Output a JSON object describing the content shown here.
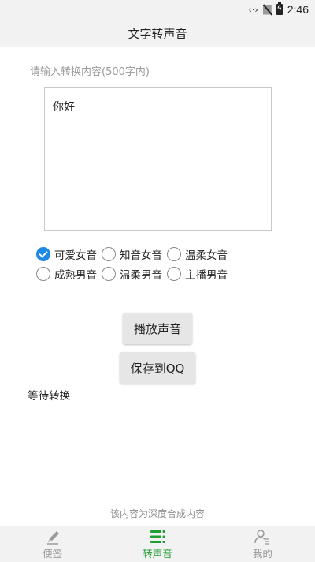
{
  "status_bar": {
    "time": "2:46",
    "network_glyph": "‹·›",
    "icons": [
      "data-icon",
      "no-sim-icon",
      "battery-charging-icon"
    ]
  },
  "app_bar": {
    "title": "文字转声音"
  },
  "input": {
    "hint": "请输入转换内容(500字内)",
    "value": "你好"
  },
  "voices": [
    {
      "label": "可爱女音",
      "checked": true
    },
    {
      "label": "知音女音",
      "checked": false
    },
    {
      "label": "温柔女音",
      "checked": false
    },
    {
      "label": "成熟男音",
      "checked": false
    },
    {
      "label": "温柔男音",
      "checked": false
    },
    {
      "label": "主播男音",
      "checked": false
    }
  ],
  "buttons": {
    "play": "播放声音",
    "save": "保存到QQ"
  },
  "status_text": "等待转换",
  "footer_note": "该内容为深度合成内容",
  "nav": {
    "items": [
      {
        "label": "便签",
        "icon": "pen-icon",
        "active": false
      },
      {
        "label": "转声音",
        "icon": "list-icon",
        "active": true
      },
      {
        "label": "我的",
        "icon": "profile-icon",
        "active": false
      }
    ]
  },
  "colors": {
    "accent_blue": "#1e88e5",
    "active_green": "#1e9e33",
    "bar_bg": "#f2f2f2"
  }
}
